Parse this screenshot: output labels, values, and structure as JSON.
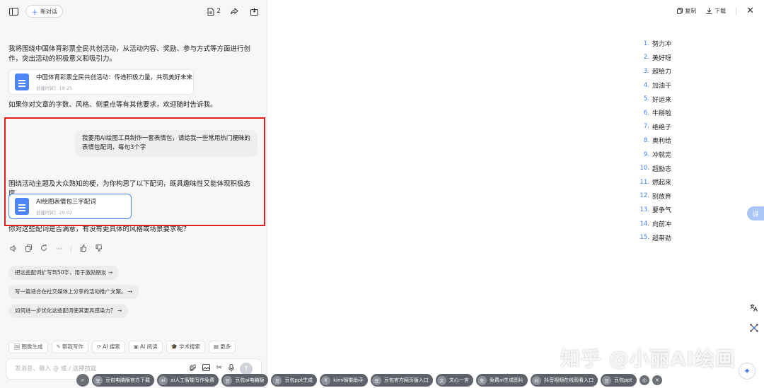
{
  "header": {
    "new_chat_label": "新对话",
    "doc_count": "2"
  },
  "conversation": {
    "intro_text": "我将围绕中国体育彩票全民共创活动，从活动内容、奖励、参与方式等方面进行创作，突出活动的积极意义和吸引力。",
    "card1": {
      "title": "中国体育彩票全民共创活动：传递积极力量，共筑美好未来",
      "time": "创建时间：19:25"
    },
    "followup1": "如果你对文章的字数、风格、侧重点等有其他要求，欢迎随时告诉我。",
    "user_message": "我要用AI绘图工具制作一套表情包，请给我一些常用热门梗昧的表情包配词，每句3个字",
    "reply_text": "围绕活动主题及大众熟知的梗，为你构思了以下配词，既具趣味性又能体现积极态度。",
    "card2": {
      "title": "AI绘图表情包三字配词",
      "time": "创建时间：20:02"
    },
    "followup2": "你对这些配词是否满意，有没有更具体的风格或场景要求呢？"
  },
  "suggestions": [
    "把这些配词扩写到50字，用于激励朋友 →",
    "写一篇适合在社交媒体上分享的活动推广文案。 →",
    "如何进一步优化这些配词使其更具感染力？ →"
  ],
  "tools": [
    {
      "icon": "🖼",
      "label": "图像生成"
    },
    {
      "icon": "✎",
      "label": "帮我写作"
    },
    {
      "icon": "⟳",
      "label": "AI 搜索"
    },
    {
      "icon": "▣",
      "label": "AI 阅读"
    },
    {
      "icon": "🎓",
      "label": "学术搜索"
    },
    {
      "icon": "▦",
      "label": "更多"
    }
  ],
  "input": {
    "placeholder": "发消息、输入 @ 或 / 选择技能"
  },
  "doc_panel": {
    "copy_label": "复制",
    "download_label": "下载",
    "phrases": [
      "努力冲",
      "美好呀",
      "超给力",
      "加油干",
      "好运来",
      "牛掰啦",
      "绝绝子",
      "奥利给",
      "冲就完",
      "超励志",
      "燃起来",
      "别放弃",
      "要争气",
      "向前冲",
      "超带劲"
    ]
  },
  "translate_label": "译",
  "watermark": "知乎 @小丽AI绘画",
  "taskbar": [
    {
      "badge": "豆",
      "label": "豆包电脑版官方下载"
    },
    {
      "badge": "ai",
      "label": "ai人工智能写作免费"
    },
    {
      "badge": "豆",
      "label": "豆包ai电脑版"
    },
    {
      "badge": "豆",
      "label": "豆包ppt生成"
    },
    {
      "badge": "K",
      "label": "kimi智能助手"
    },
    {
      "badge": "豆",
      "label": "豆包官方网页版入口"
    },
    {
      "badge": "文",
      "label": "文心一言"
    },
    {
      "badge": "免",
      "label": "免费ai生成图片"
    },
    {
      "badge": "抖",
      "label": "抖音视频在线观看入口"
    },
    {
      "badge": "豆",
      "label": "豆包ppt"
    }
  ]
}
